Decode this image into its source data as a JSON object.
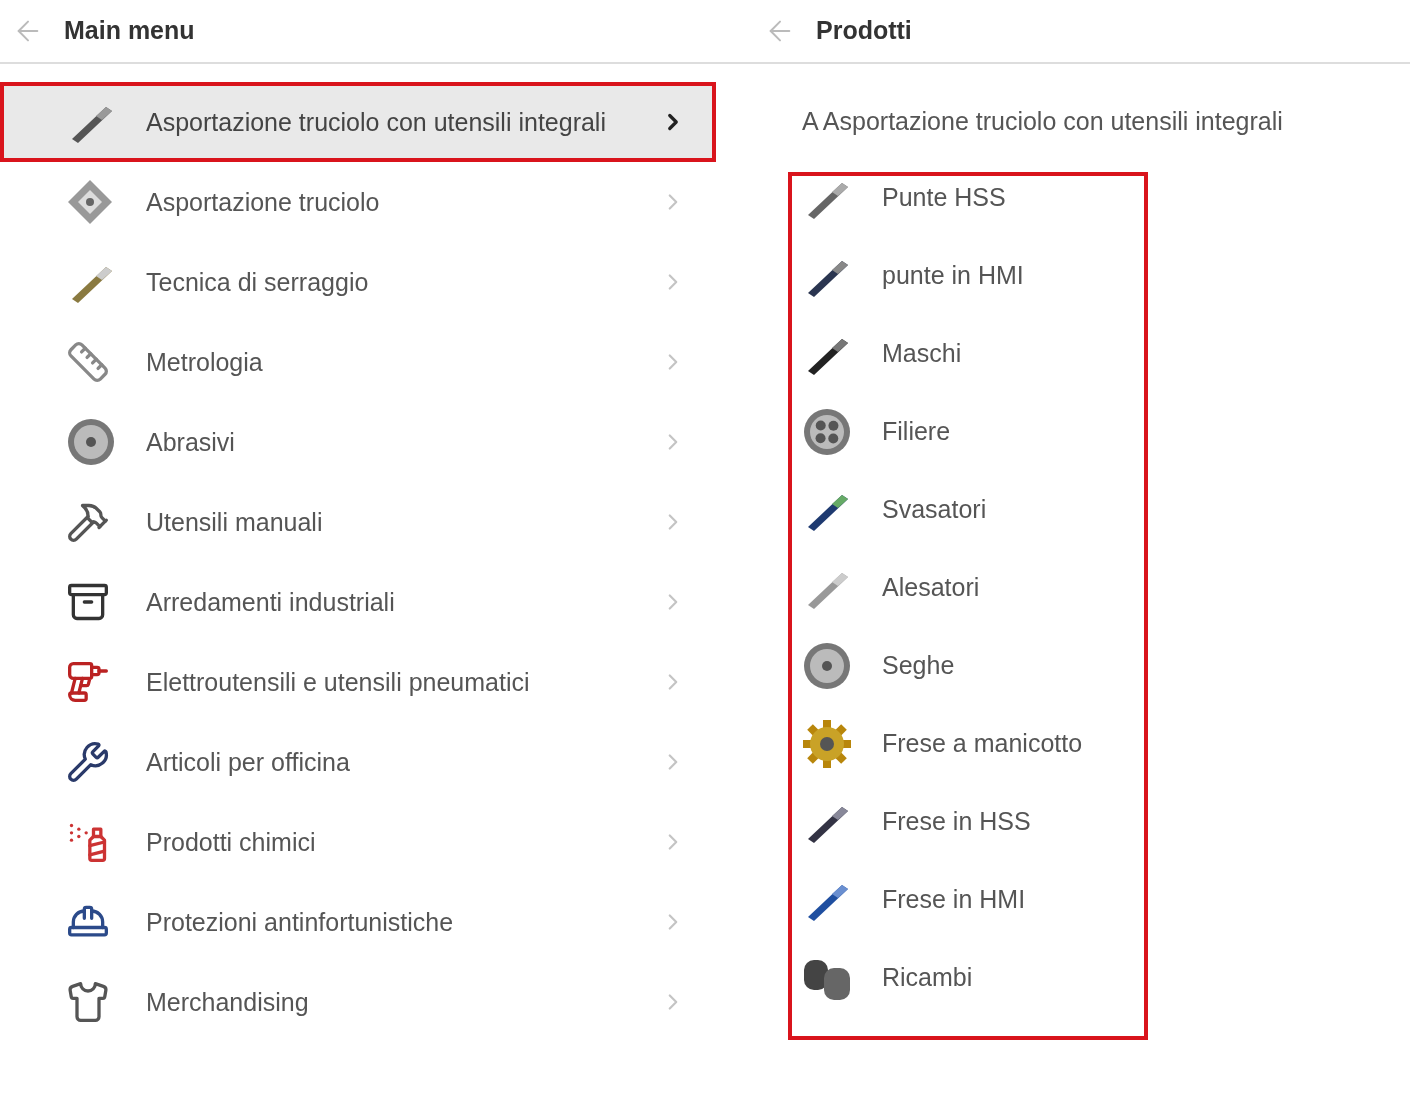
{
  "main_menu": {
    "title": "Main menu",
    "items": [
      {
        "label": "Asportazione truciolo con utensili integrali",
        "selected": true,
        "highlighted": true
      },
      {
        "label": "Asportazione truciolo",
        "selected": false,
        "highlighted": false
      },
      {
        "label": "Tecnica di serraggio",
        "selected": false,
        "highlighted": false
      },
      {
        "label": "Metrologia",
        "selected": false,
        "highlighted": false
      },
      {
        "label": "Abrasivi",
        "selected": false,
        "highlighted": false
      },
      {
        "label": "Utensili manuali",
        "selected": false,
        "highlighted": false
      },
      {
        "label": "Arredamenti industriali",
        "selected": false,
        "highlighted": false
      },
      {
        "label": "Elettroutensili e utensili pneumatici",
        "selected": false,
        "highlighted": false
      },
      {
        "label": "Articoli per officina",
        "selected": false,
        "highlighted": false
      },
      {
        "label": "Prodotti chimici",
        "selected": false,
        "highlighted": false
      },
      {
        "label": "Protezioni antinfortunistiche",
        "selected": false,
        "highlighted": false
      },
      {
        "label": "Merchandising",
        "selected": false,
        "highlighted": false
      }
    ]
  },
  "products": {
    "title": "Prodotti",
    "subtitle": "A Asportazione truciolo con utensili integrali",
    "highlighted": true,
    "items": [
      {
        "label": "Punte HSS"
      },
      {
        "label": "punte in HMI"
      },
      {
        "label": "Maschi"
      },
      {
        "label": "Filiere"
      },
      {
        "label": "Svasatori"
      },
      {
        "label": "Alesatori"
      },
      {
        "label": "Seghe"
      },
      {
        "label": "Frese a manicotto"
      },
      {
        "label": "Frese in HSS"
      },
      {
        "label": "Frese in HMI"
      },
      {
        "label": "Ricambi"
      }
    ]
  }
}
